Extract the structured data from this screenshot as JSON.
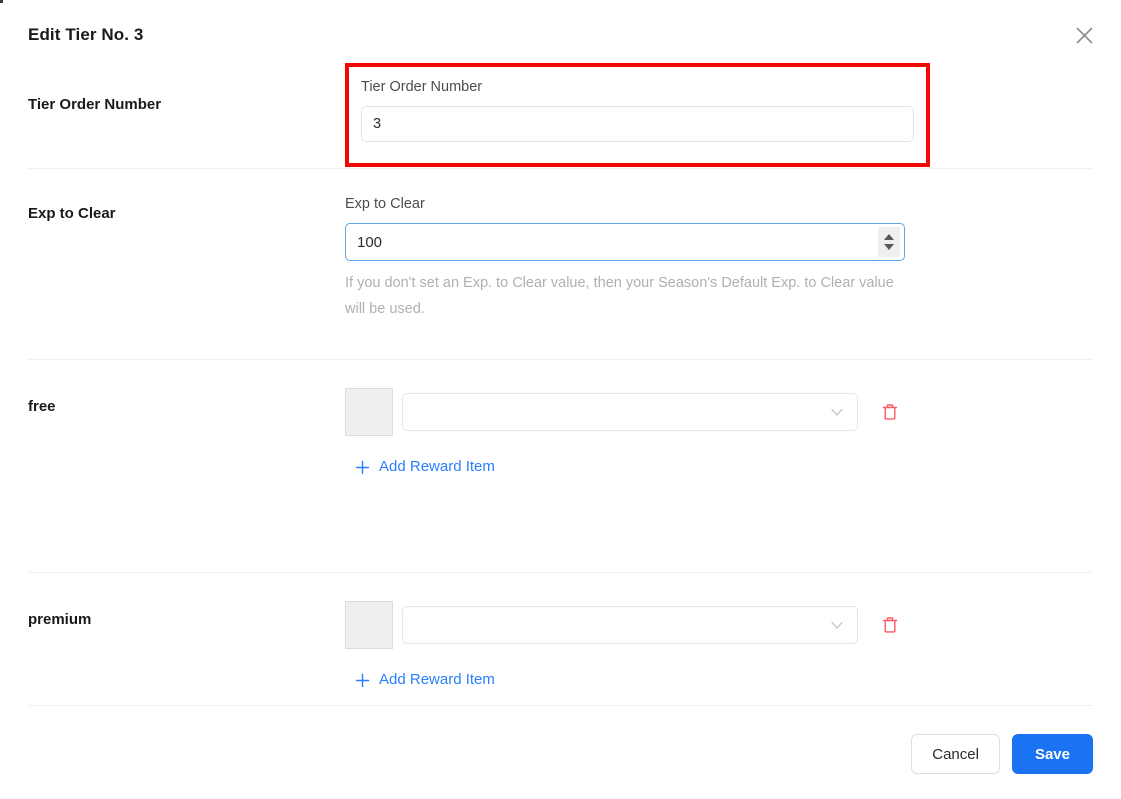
{
  "header": {
    "title": "Edit Tier No. 3",
    "close_icon": "close-icon"
  },
  "rows": {
    "tier_order": {
      "label": "Tier Order Number",
      "field_label": "Tier Order Number",
      "value": "3",
      "highlight_color": "#f10800"
    },
    "exp_to_clear": {
      "label": "Exp to Clear",
      "field_label": "Exp to Clear",
      "value": "100",
      "help_text": "If you don't set an Exp. to Clear value, then your Season's Default Exp. to Clear value will be used.",
      "focus_color": "#5aa6e8"
    },
    "free": {
      "label": "free",
      "select_value": "",
      "select_icon": "chevron-down-icon",
      "delete_icon": "trash-icon",
      "add_label": "Add Reward Item",
      "add_icon": "plus-icon"
    },
    "premium": {
      "label": "premium",
      "select_value": "",
      "select_icon": "chevron-down-icon",
      "delete_icon": "trash-icon",
      "add_label": "Add Reward Item",
      "add_icon": "plus-icon"
    }
  },
  "footer": {
    "cancel_label": "Cancel",
    "save_label": "Save",
    "save_color": "#1a73f2"
  }
}
